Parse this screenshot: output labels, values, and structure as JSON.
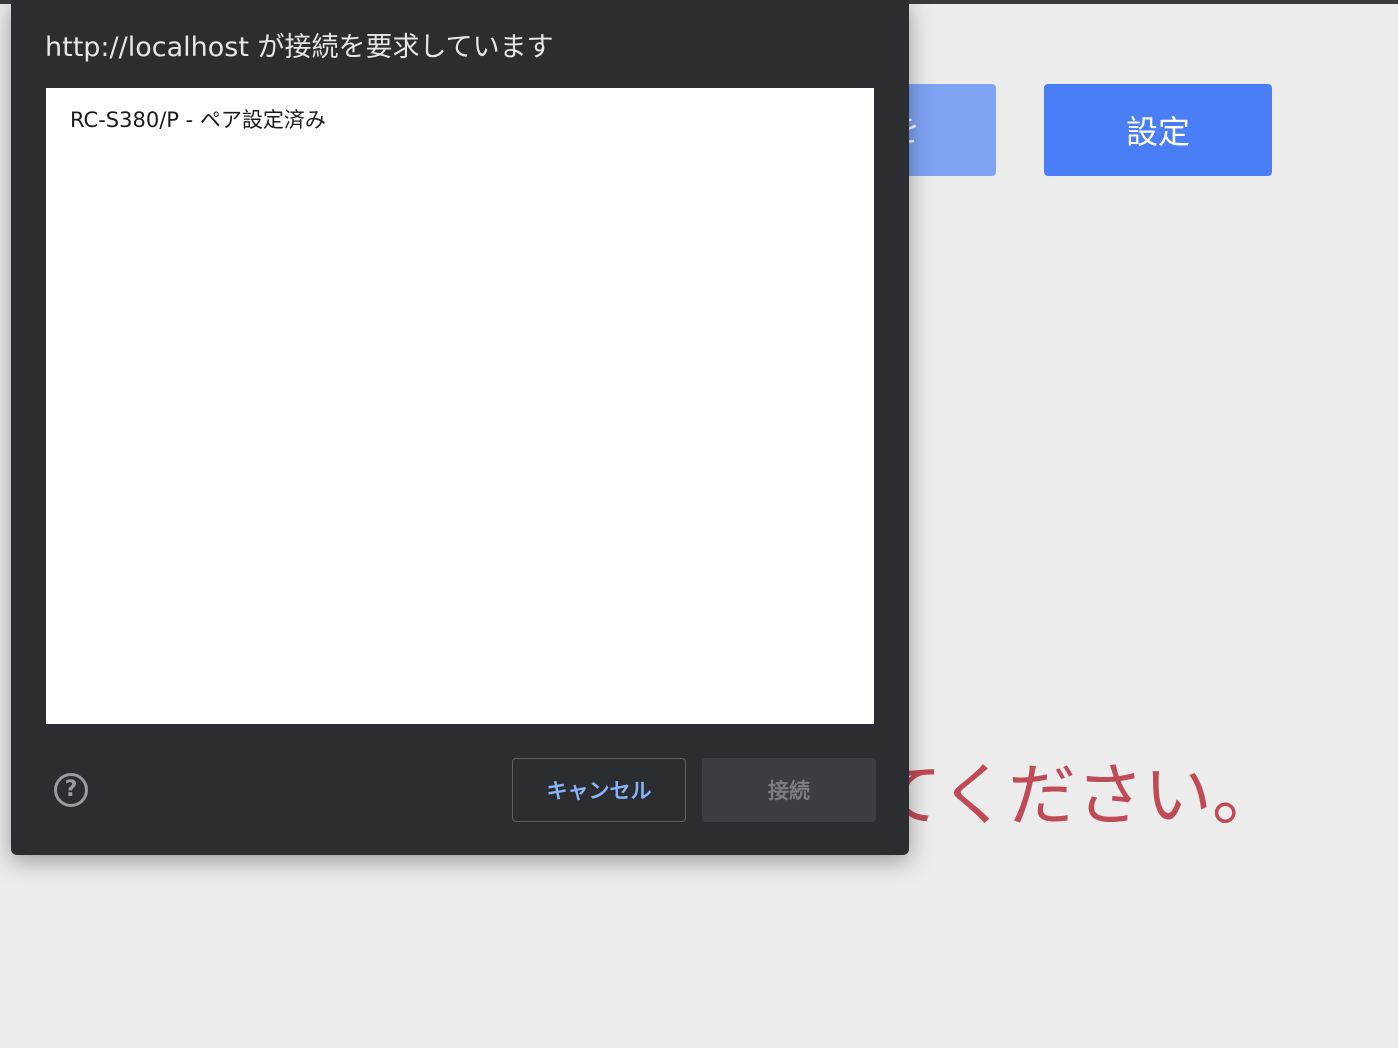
{
  "page": {
    "partial_button_label": "を",
    "settings_button_label": "設定",
    "message_text": "てください。"
  },
  "dialog": {
    "title": "http://localhost が接続を要求しています",
    "devices": [
      {
        "label": "RC-S380/P - ペア設定済み"
      }
    ],
    "help_icon": "question-circle-icon",
    "help_glyph": "?",
    "cancel_label": "キャンセル",
    "connect_label": "接続"
  },
  "colors": {
    "dialog_bg": "#2c2d31",
    "primary_blue": "#4a7ef6",
    "cancel_text": "#8ab4f8",
    "message_red": "#c04a55"
  }
}
